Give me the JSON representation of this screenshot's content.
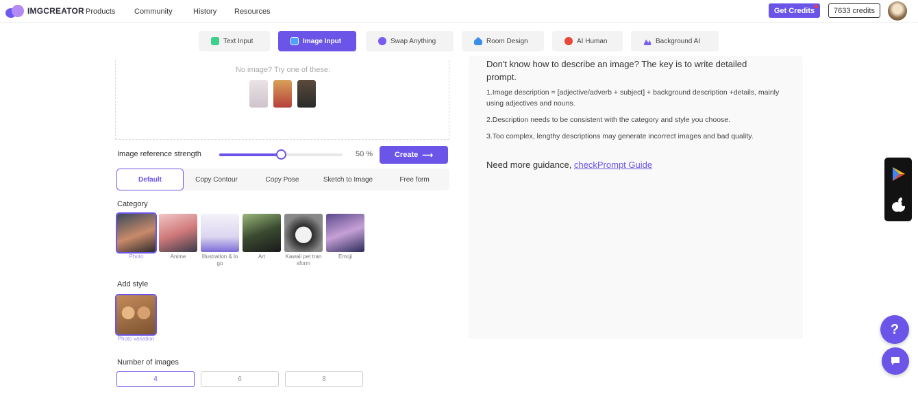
{
  "header": {
    "logo_text": "IMGCREATOR",
    "nav": [
      "Products",
      "Community",
      "History",
      "Resources"
    ],
    "get_credits": "Get Credits",
    "credits": "7633 credits"
  },
  "tabs": [
    {
      "label": "Text Input",
      "icon": "text-icon",
      "color": "#3ecf8e"
    },
    {
      "label": "Image Input",
      "icon": "image-icon",
      "color": "#4aa3ff"
    },
    {
      "label": "Swap Anything",
      "icon": "palette-icon",
      "color": "#7b5cf0"
    },
    {
      "label": "Room Design",
      "icon": "house-icon",
      "color": "#3a8fe8"
    },
    {
      "label": "AI Human",
      "icon": "human-icon",
      "color": "#e8473a"
    },
    {
      "label": "Background AI",
      "icon": "mountain-icon",
      "color": "#7b5cf0"
    }
  ],
  "upload": {
    "no_image": "No image? Try one of these:"
  },
  "strength": {
    "label": "Image reference strength",
    "value": "50 %",
    "level": 0.5
  },
  "create_label": "Create",
  "modes": [
    "Default",
    "Copy Contour",
    "Copy Pose",
    "Sketch to Image",
    "Free form"
  ],
  "category": {
    "label": "Category",
    "items": [
      "Photo",
      "Anime",
      "Illustration & logo",
      "Art",
      "Kawaii pet transform",
      "Emoji"
    ]
  },
  "add_style": {
    "label": "Add style",
    "items": [
      "Photo variation"
    ]
  },
  "num_images": {
    "label": "Number of images",
    "options": [
      "4",
      "6",
      "8"
    ]
  },
  "tips": {
    "head": "Don't know how to describe an image? The key is to write detailed prompt.",
    "p1": "1.Image description = [adjective/adverb + subject] + background description +details, mainly using adjectives and nouns.",
    "p2": "2.Description needs to be consistent with the category and style you choose.",
    "p3": "3.Too complex, lengthy descriptions may generate incorrect images and bad quality.",
    "guide_prefix": "Need more guidance, ",
    "guide_link": "checkPrompt Guide"
  },
  "help_symbol": "?"
}
